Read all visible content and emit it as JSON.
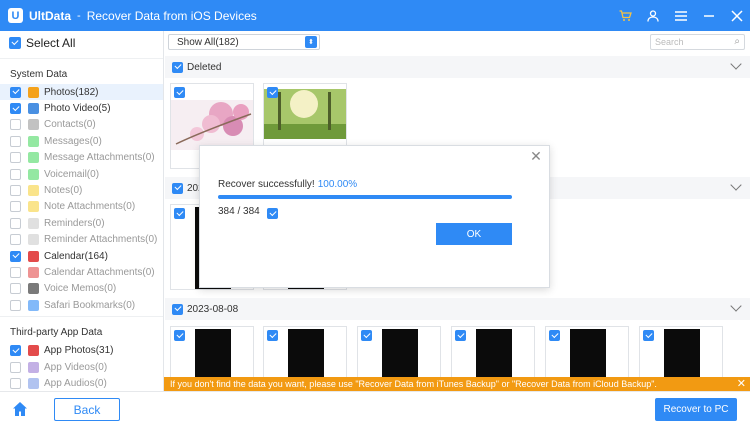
{
  "titlebar": {
    "app_name": "UltData",
    "separator": "-",
    "subtitle": "Recover Data from iOS Devices",
    "icons": [
      "cart-icon",
      "user-icon",
      "menu-icon",
      "minimize-icon",
      "close-icon"
    ]
  },
  "sidebar": {
    "select_all": "Select All",
    "sections": [
      {
        "label": "System Data",
        "items": [
          {
            "label": "Photos(182)",
            "checked": true,
            "icon": "photos-icon",
            "color": "#f4a21c"
          },
          {
            "label": "Photo Video(5)",
            "checked": true,
            "icon": "photo-video-icon",
            "color": "#4a90e2"
          },
          {
            "label": "Contacts(0)",
            "checked": false,
            "icon": "contacts-icon",
            "color": "#9a9a9a"
          },
          {
            "label": "Messages(0)",
            "checked": false,
            "icon": "messages-icon",
            "color": "#4cd964"
          },
          {
            "label": "Message Attachments(0)",
            "checked": false,
            "icon": "message-attachments-icon",
            "color": "#4cd964"
          },
          {
            "label": "Voicemail(0)",
            "checked": false,
            "icon": "voicemail-icon",
            "color": "#4cd964"
          },
          {
            "label": "Notes(0)",
            "checked": false,
            "icon": "notes-icon",
            "color": "#f7d23e"
          },
          {
            "label": "Note Attachments(0)",
            "checked": false,
            "icon": "note-attachments-icon",
            "color": "#f7d23e"
          },
          {
            "label": "Reminders(0)",
            "checked": false,
            "icon": "reminders-icon",
            "color": "#cccccc"
          },
          {
            "label": "Reminder Attachments(0)",
            "checked": false,
            "icon": "reminder-attachments-icon",
            "color": "#cccccc"
          },
          {
            "label": "Calendar(164)",
            "checked": true,
            "icon": "calendar-icon",
            "color": "#e34b4b"
          },
          {
            "label": "Calendar Attachments(0)",
            "checked": false,
            "icon": "calendar-attachments-icon",
            "color": "#e34b4b"
          },
          {
            "label": "Voice Memos(0)",
            "checked": false,
            "icon": "voice-memos-icon",
            "color": "#222222"
          },
          {
            "label": "Safari Bookmarks(0)",
            "checked": false,
            "icon": "safari-icon",
            "color": "#2f8af5"
          }
        ]
      },
      {
        "label": "Third-party App Data",
        "items": [
          {
            "label": "App Photos(31)",
            "checked": true,
            "icon": "app-photos-icon",
            "color": "#e34b4b"
          },
          {
            "label": "App Videos(0)",
            "checked": false,
            "icon": "app-videos-icon",
            "color": "#9b7bd4"
          },
          {
            "label": "App Audios(0)",
            "checked": false,
            "icon": "app-audios-icon",
            "color": "#7d9be6"
          }
        ]
      }
    ]
  },
  "main": {
    "filter_value": "Show All(182)",
    "search_placeholder": "Search",
    "groups": [
      {
        "label": "Deleted"
      },
      {
        "label": "202"
      },
      {
        "label": "2023-08-08"
      }
    ]
  },
  "modal": {
    "message": "Recover successfully!",
    "percent": "100.00%",
    "progress": 1.0,
    "count": "384 / 384",
    "ok_label": "OK"
  },
  "notice": {
    "text": "If you don't find the data you want, please use \"Recover Data from iTunes Backup\" or \"Recover Data from iCloud Backup\"."
  },
  "bottom": {
    "back_label": "Back",
    "recover_label": "Recover to PC"
  },
  "colors": {
    "accent": "#2f8af5",
    "notice": "#f29a12"
  }
}
